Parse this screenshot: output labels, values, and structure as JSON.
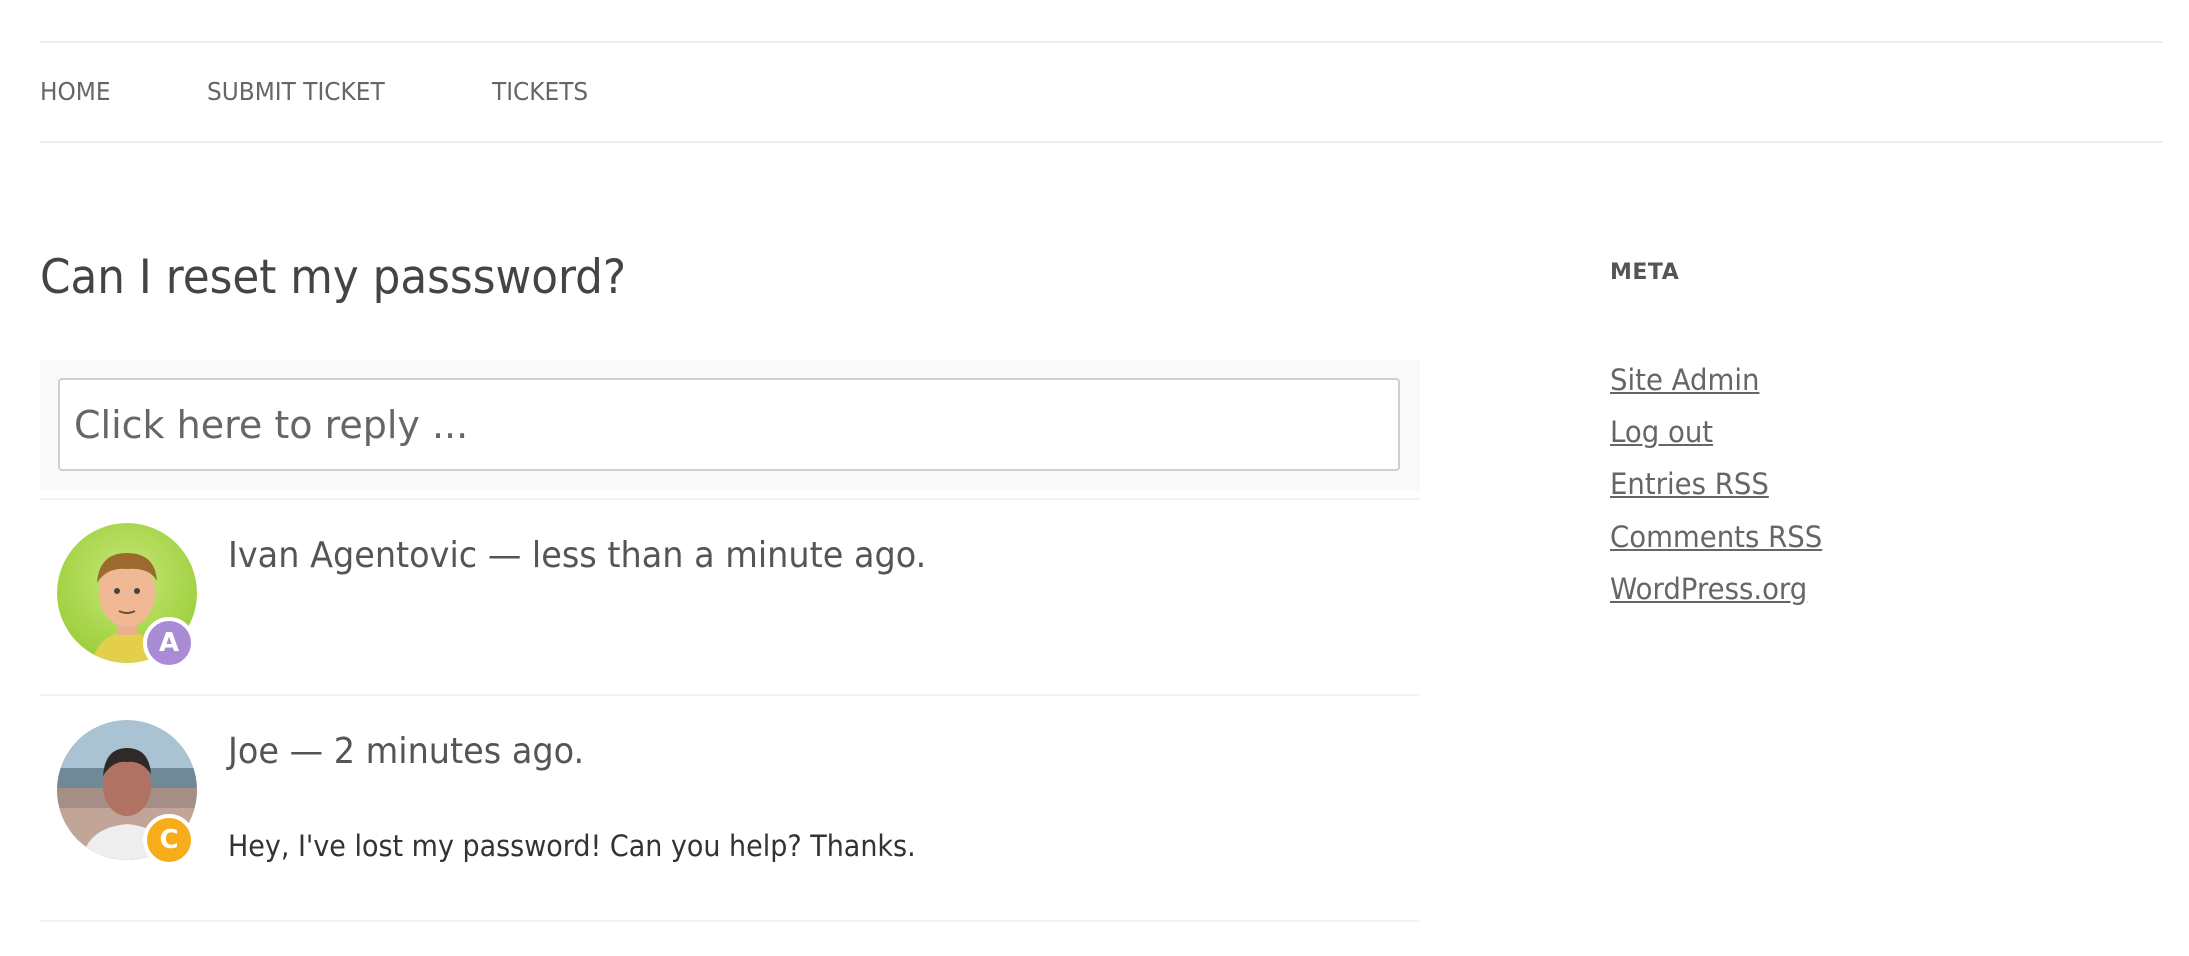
{
  "nav": {
    "items": [
      {
        "label": "HOME"
      },
      {
        "label": "SUBMIT TICKET"
      },
      {
        "label": "TICKETS"
      }
    ]
  },
  "ticket": {
    "title": "Can I reset my passsword?",
    "reply_placeholder": "Click here to reply ..."
  },
  "comments": [
    {
      "author": "Ivan Agentovic",
      "time": "less than a minute ago.",
      "meta": "Ivan Agentovic — less than a minute ago.",
      "body": "",
      "avatar": "cartoon-avatar",
      "role_badge": "A",
      "role_color": "#a98bd6"
    },
    {
      "author": "Joe",
      "time": "2 minutes ago.",
      "meta": "Joe — 2 minutes ago.",
      "body": "Hey, I've lost my password! Can you help? Thanks.",
      "avatar": "photo-avatar",
      "role_badge": "C",
      "role_color": "#f7ad19"
    }
  ],
  "sidebar": {
    "widget_title": "META",
    "links": [
      {
        "label": "Site Admin"
      },
      {
        "label": "Log out"
      },
      {
        "label": "Entries RSS"
      },
      {
        "label": "Comments RSS"
      },
      {
        "label": "WordPress.org"
      }
    ]
  }
}
